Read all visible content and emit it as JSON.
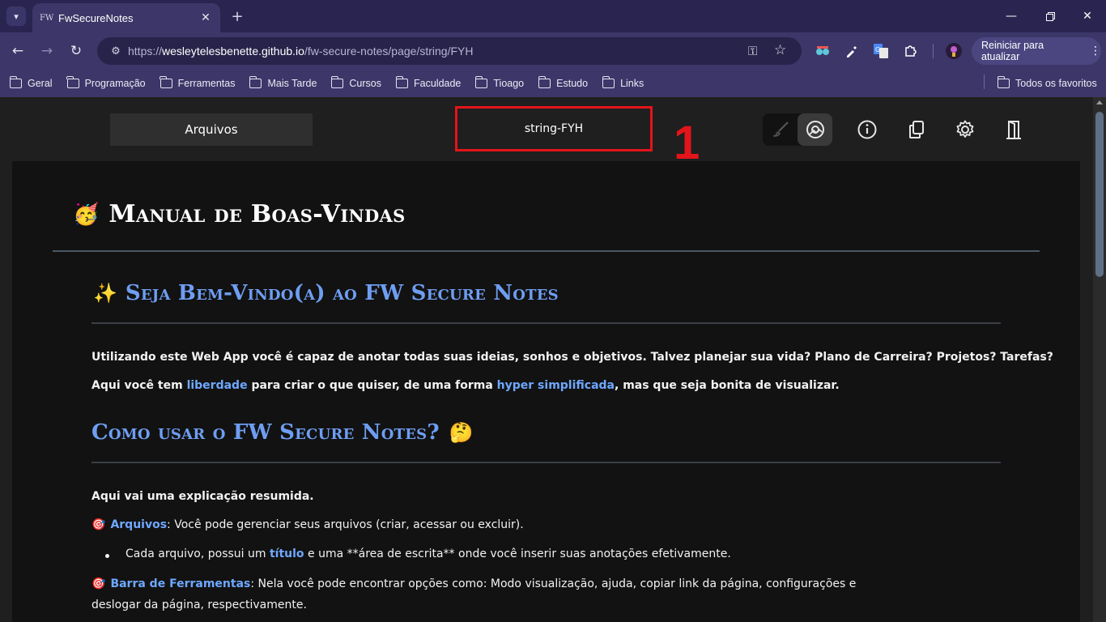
{
  "browser": {
    "tab_favicon": "FW",
    "tab_title": "FwSecureNotes",
    "url_prefix": "https://",
    "url_domain": "wesleytelesbenette.github.io",
    "url_path": "/fw-secure-notes/page/string/FYH",
    "update_button": "Reiniciar para atualizar",
    "bookmarks": [
      "Geral",
      "Programação",
      "Ferramentas",
      "Mais Tarde",
      "Cursos",
      "Faculdade",
      "Tioago",
      "Estudo",
      "Links"
    ],
    "all_bookmarks": "Todos os favoritos"
  },
  "page": {
    "files_button": "Arquivos",
    "note_title": "string-FYH",
    "annotation_number": "1",
    "h1_emoji": "🥳",
    "h1": "Manual de Boas-Vindas",
    "welcome_emoji": "✨",
    "welcome_heading": "Seja Bem-Vindo(a) ao FW Secure Notes",
    "intro_line1": "Utilizando este Web App você é capaz de anotar todas suas ideias, sonhos e objetivos. Talvez planejar sua vida? Plano de Carreira? Projetos? Tarefas?",
    "intro_line2_a": "Aqui você tem ",
    "intro_line2_link1": "liberdade",
    "intro_line2_b": " para criar o que quiser, de uma forma ",
    "intro_line2_link2": "hyper simplificada",
    "intro_line2_c": ", mas que seja bonita de visualizar.",
    "howto_heading": "Como usar o FW Secure Notes?",
    "howto_emoji": "🤔",
    "explain": "Aqui vai uma explicação resumida.",
    "target_emoji": "🎯",
    "files_link": "Arquivos",
    "files_text": ": Você pode gerenciar seus arquivos (criar, acessar ou excluir).",
    "bullet_a": "Cada arquivo, possui um ",
    "bullet_link": "título",
    "bullet_b": " e uma **área de escrita** onde você inserir suas anotações efetivamente.",
    "toolbar_link": "Barra de Ferramentas",
    "toolbar_text": ": Nela você pode encontrar opções como: Modo visualização, ajuda, copiar link da página, configurações e",
    "toolbar_text2": "deslogar da página, respectivamente."
  }
}
